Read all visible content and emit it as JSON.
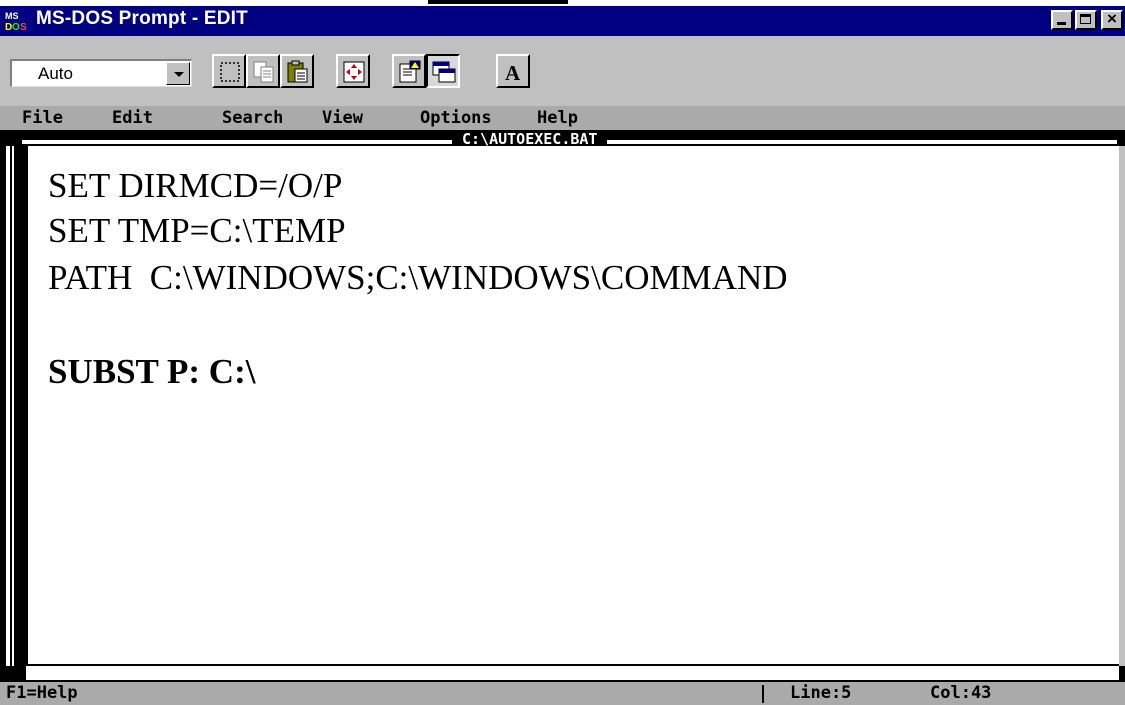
{
  "window": {
    "title": "MS-DOS Prompt - EDIT"
  },
  "toolbar": {
    "font_size_value": "Auto",
    "buttons": [
      {
        "name": "mark-icon"
      },
      {
        "name": "copy-icon"
      },
      {
        "name": "paste-icon"
      },
      {
        "name": "fullscreen-icon"
      },
      {
        "name": "properties-icon"
      },
      {
        "name": "background-icon"
      },
      {
        "name": "font-icon",
        "glyph": "A"
      }
    ]
  },
  "menu": {
    "items": [
      "File",
      "Edit",
      "Search",
      "View",
      "Options",
      "Help"
    ]
  },
  "editor": {
    "filename": "C:\\AUTOEXEC.BAT",
    "lines": [
      "SET DIRMCD=/O/P",
      "SET TMP=C:\\TEMP",
      "PATH  C:\\WINDOWS;C:\\WINDOWS\\COMMAND",
      "",
      "SUBST P: C:\\"
    ]
  },
  "status": {
    "help": "F1=Help",
    "line": "Line:5",
    "col": "Col:43"
  },
  "colors": {
    "titlebar": "#000080",
    "menubar": "#aaaaaa",
    "chrome": "#c0c0c0"
  }
}
